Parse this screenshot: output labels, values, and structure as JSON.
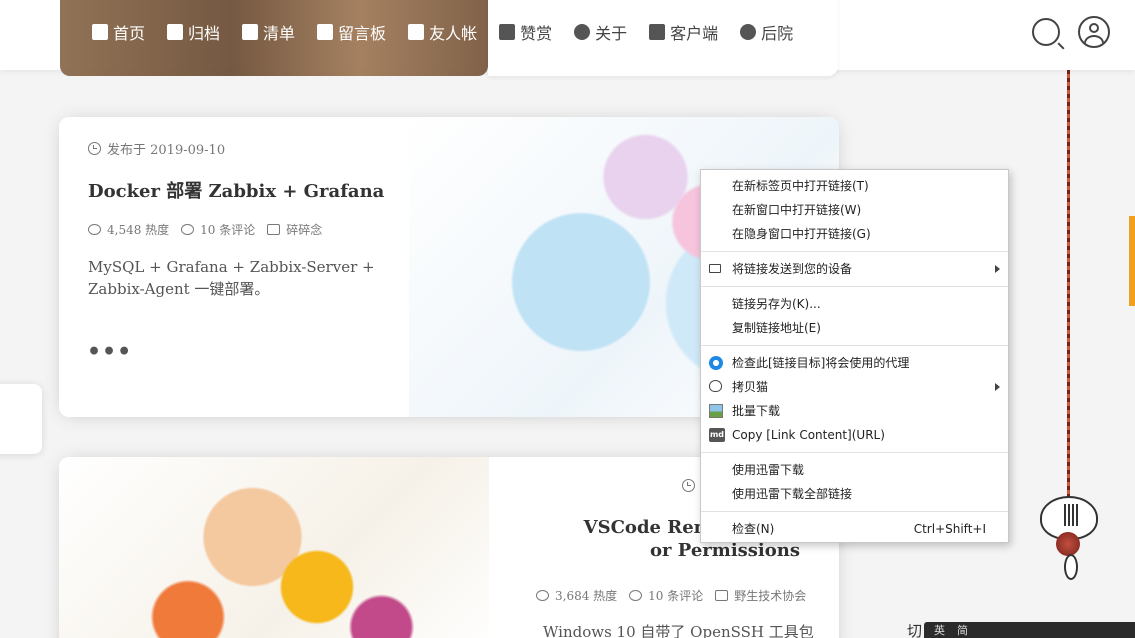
{
  "nav": {
    "items": [
      {
        "label": "首页",
        "icon": "castle-icon"
      },
      {
        "label": "归档",
        "icon": "archive-icon"
      },
      {
        "label": "清单",
        "icon": "list-icon"
      },
      {
        "label": "留言板",
        "icon": "edit-icon"
      },
      {
        "label": "友人帐",
        "icon": "link-icon"
      },
      {
        "label": "赞赏",
        "icon": "heart-icon"
      },
      {
        "label": "关于",
        "icon": "leaf-icon"
      },
      {
        "label": "客户端",
        "icon": "android-icon"
      },
      {
        "label": "后院",
        "icon": "chrome-icon"
      }
    ]
  },
  "posts": [
    {
      "date": "发布于 2019-09-10",
      "title": "Docker 部署 Zabbix + Grafana",
      "views": "4,548 热度",
      "comments": "10 条评论",
      "category": "碎碎念",
      "excerpt_line1": "MySQL + Grafana + Zabbix-Server +",
      "excerpt_line2": "Zabbix-Agent 一键部署。",
      "more": "•••"
    },
    {
      "title_line1": "VSCode Remote SSH:",
      "title_line2": "or Permissions",
      "views": "3,684 热度",
      "comments": "10 条评论",
      "category": "野生技术协会",
      "excerpt": "Windows 10 自带了 OpenSSH 工具包"
    }
  ],
  "context_menu": {
    "items": [
      {
        "label": "在新标签页中打开链接(T)"
      },
      {
        "label": "在新窗口中打开链接(W)"
      },
      {
        "label": "在隐身窗口中打开链接(G)"
      },
      {
        "label": "将链接发送到您的设备",
        "icon": "device-icon",
        "submenu": true
      },
      {
        "label": "链接另存为(K)..."
      },
      {
        "label": "复制链接地址(E)"
      },
      {
        "label": "检查此[链接目标]将会使用的代理",
        "icon": "proxy-icon"
      },
      {
        "label": "拷贝猫",
        "icon": "cat-icon",
        "submenu": true
      },
      {
        "label": "批量下载",
        "icon": "image-icon"
      },
      {
        "label": "Copy [Link Content](URL)",
        "icon": "markdown-icon",
        "icon_text": "md"
      },
      {
        "label": "使用迅雷下载"
      },
      {
        "label": "使用迅雷下载全部链接"
      },
      {
        "label": "检查(N)",
        "shortcut": "Ctrl+Shift+I"
      }
    ]
  },
  "bottom_text": "切",
  "taskbar": {
    "items": [
      "英",
      "简"
    ]
  },
  "colors": {
    "accent": "#f0a020",
    "proxy_blue": "#1e88e5"
  }
}
